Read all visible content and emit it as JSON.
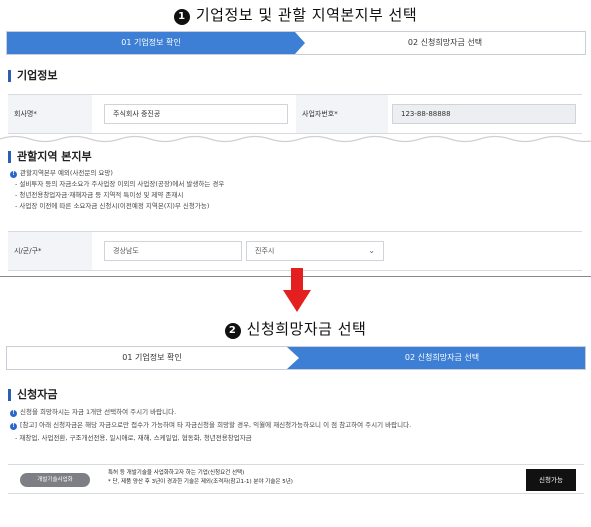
{
  "panel1": {
    "step_number": "1",
    "heading": "기업정보 및 관할 지역본지부 선택",
    "steps": [
      {
        "label": "01 기업정보 확인"
      },
      {
        "label": "02 신청희망자금 선택"
      }
    ],
    "company_section_title": "기업정보",
    "company_name_label": "회사명*",
    "company_name_value": "주식회사 중진공",
    "biz_number_label": "사업자번호*",
    "biz_number_value": "123-88-88888",
    "region_section_title": "관할지역 본지부",
    "info_items": [
      "관할지역본부 예외(사전문의 요망)",
      "- 설비투자 등의 자금소요가 주사업장 이외의 사업장(공장)에서 발생하는 경우",
      "- 청년전용창업자금·재해자금 등 지역적 특이성 및 제약 존재시",
      "- 사업장 이전에 따른 소요자금 신청시(이전예정 지역본(지)부 신청가능)"
    ],
    "region_label": "시/군/구*",
    "select_province": "경상남도",
    "select_city": "진주시"
  },
  "panel2": {
    "step_number": "2",
    "heading": "신청희망자금 선택",
    "steps": [
      {
        "label": "01 기업정보 확인"
      },
      {
        "label": "02 신청희망자금 선택"
      }
    ],
    "fund_section_title": "신청자금",
    "info_items": [
      "신청을 희망하시는 자금 1개만 선택하여 주시기 바랍니다.",
      "[참고] 아래 신청자금은 해당 자금으로만 접수가 가능하며 타 자금신청을 희망할 경우, 익월에 재신청가능하오니 이 점 참고하여 주시기 바랍니다.",
      "- 재창업, 사업전환, 구조개선전용, 일시애로, 재해, 스케일업, 협동화, 청년전용창업자금"
    ],
    "fund_pill": "개발기술사업화",
    "fund_desc_line1": "특허 등 개발기술을 사업화하고자 하는 기업(신청요건 선택)",
    "fund_desc_line2": "* 단, 제품 양산 후 3년이 경과한 기술은 제외(조격자(참고1-1) 분야 기술은 5년)",
    "apply_button": "신청가능"
  },
  "colors": {
    "step_active": "#3d7fd4",
    "arrow": "#e41f1f",
    "accent_bar": "#2b5fb3",
    "button": "#111111"
  }
}
